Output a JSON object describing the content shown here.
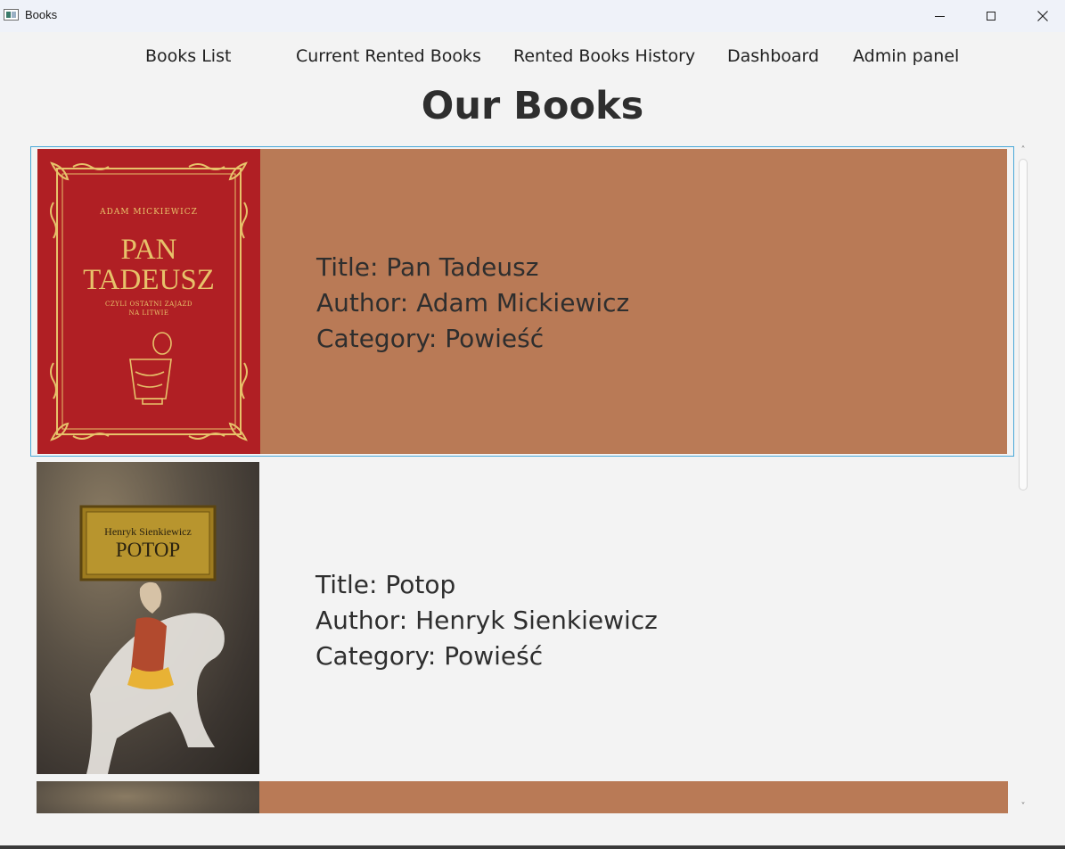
{
  "window": {
    "title": "Books",
    "icon": "app-window-icon",
    "controls": {
      "minimize": "minimize-icon",
      "maximize": "maximize-icon",
      "close": "close-icon"
    }
  },
  "nav": {
    "items": [
      {
        "label": "Books List"
      },
      {
        "label": "Current Rented Books"
      },
      {
        "label": "Rented Books History"
      },
      {
        "label": "Dashboard"
      },
      {
        "label": "Admin panel"
      }
    ]
  },
  "page": {
    "title": "Our Books"
  },
  "books": [
    {
      "cover_author": "ADAM MICKIEWICZ",
      "cover_title_line1": "PAN",
      "cover_title_line2": "TADEUSZ",
      "cover_subtitle_line1": "CZYLI OSTATNI ZAJAZD",
      "cover_subtitle_line2": "NA LITWIE",
      "title": "Title: Pan Tadeusz",
      "author": "Author: Adam Mickiewicz",
      "category": "Category: Powieść"
    },
    {
      "cover_author": "Henryk Sienkiewicz",
      "cover_title_line1": "POTOP",
      "title": "Title: Potop",
      "author": "Author: Henryk Sienkiewicz",
      "category": "Category: Powieść"
    }
  ],
  "colors": {
    "row_highlight": "#b97a56",
    "selection_border": "#4aa8d8",
    "cover1_red": "#b01f24",
    "cover1_gold": "#e7c26a"
  }
}
